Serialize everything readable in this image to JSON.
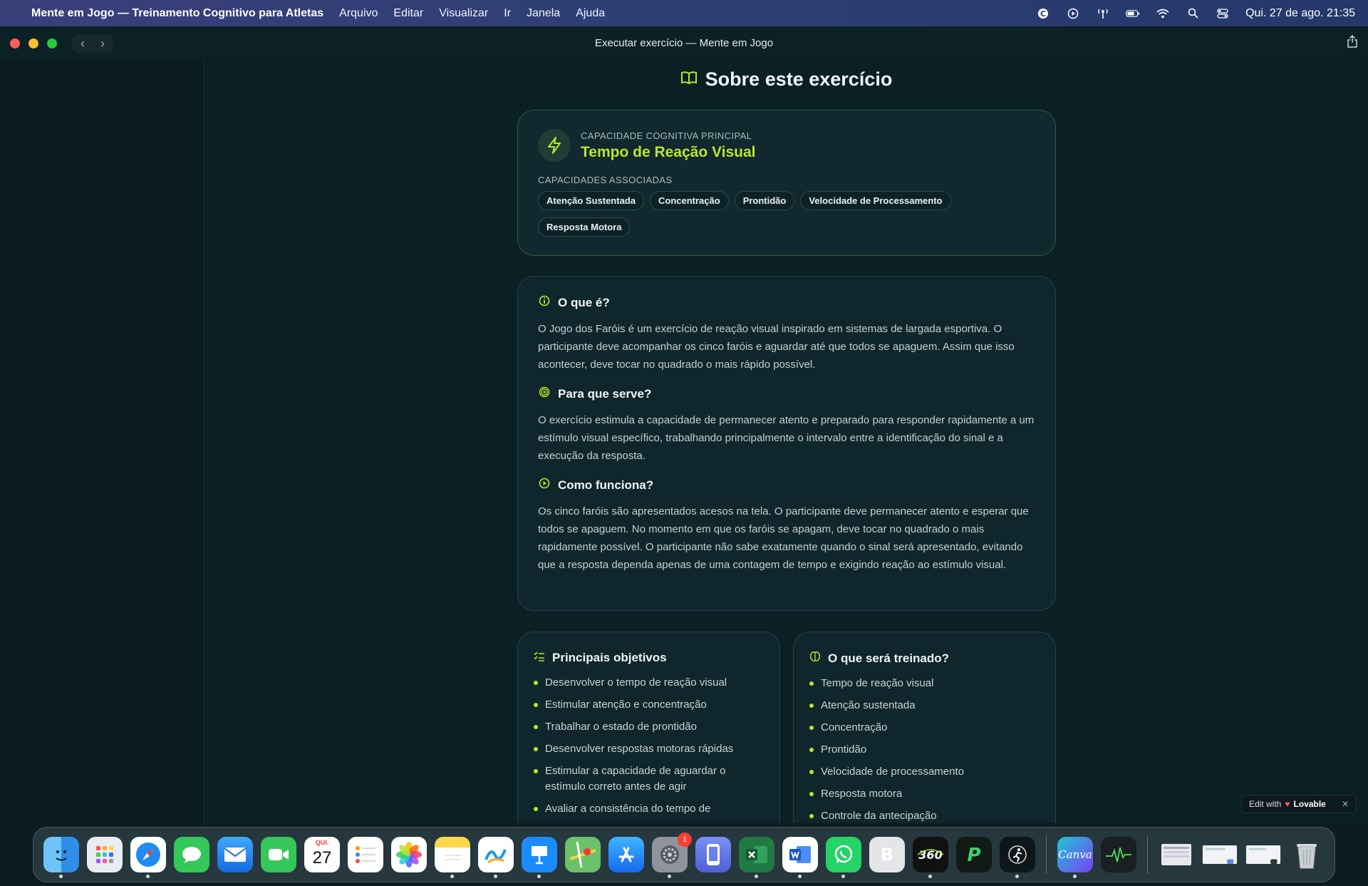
{
  "menubar": {
    "app_name": "Mente em Jogo — Treinamento Cognitivo para Atletas",
    "menus": [
      "Arquivo",
      "Editar",
      "Visualizar",
      "Ir",
      "Janela",
      "Ajuda"
    ],
    "clock": "Qui. 27 de ago.  21:35"
  },
  "window": {
    "title": "Executar exercício — Mente em Jogo"
  },
  "page": {
    "title": "Sobre este exercício",
    "capability": {
      "main_label": "CAPACIDADE COGNITIVA PRINCIPAL",
      "main_value": "Tempo de Reação Visual",
      "assoc_label": "CAPACIDADES ASSOCIADAS",
      "chips": [
        "Atenção Sustentada",
        "Concentração",
        "Prontidão",
        "Velocidade de Processamento",
        "Resposta Motora"
      ]
    },
    "info": {
      "what_title": "O que é?",
      "what_text": "O Jogo dos Faróis é um exercício de reação visual inspirado em sistemas de largada esportiva. O participante deve acompanhar os cinco faróis e aguardar até que todos se apaguem. Assim que isso acontecer, deve tocar no quadrado o mais rápido possível.",
      "purpose_title": "Para que serve?",
      "purpose_text": "O exercício estimula a capacidade de permanecer atento e preparado para responder rapidamente a um estímulo visual específico, trabalhando principalmente o intervalo entre a identificação do sinal e a execução da resposta.",
      "how_title": "Como funciona?",
      "how_text": "Os cinco faróis são apresentados acesos na tela. O participante deve permanecer atento e esperar que todos se apaguem. No momento em que os faróis se apagam, deve tocar no quadrado o mais rapidamente possível. O participante não sabe exatamente quando o sinal será apresentado, evitando que a resposta dependa apenas de uma contagem de tempo e exigindo reação ao estímulo visual."
    },
    "objectives": {
      "title": "Principais objetivos",
      "items": [
        "Desenvolver o tempo de reação visual",
        "Estimular atenção e concentração",
        "Trabalhar o estado de prontidão",
        "Desenvolver respostas motoras rápidas",
        "Estimular a capacidade de aguardar o estímulo correto antes de agir",
        "Avaliar a consistência do tempo de"
      ]
    },
    "training": {
      "title": "O que será treinado?",
      "items": [
        "Tempo de reação visual",
        "Atenção sustentada",
        "Concentração",
        "Prontidão",
        "Velocidade de processamento",
        "Resposta motora",
        "Controle da antecipação"
      ]
    }
  },
  "lovable": {
    "edit_with": "Edit with",
    "brand": "Lovable"
  },
  "dock": {
    "calendar_day": "QUI.",
    "calendar_num": "27",
    "settings_badge": "1",
    "canva_label": "Canva"
  }
}
